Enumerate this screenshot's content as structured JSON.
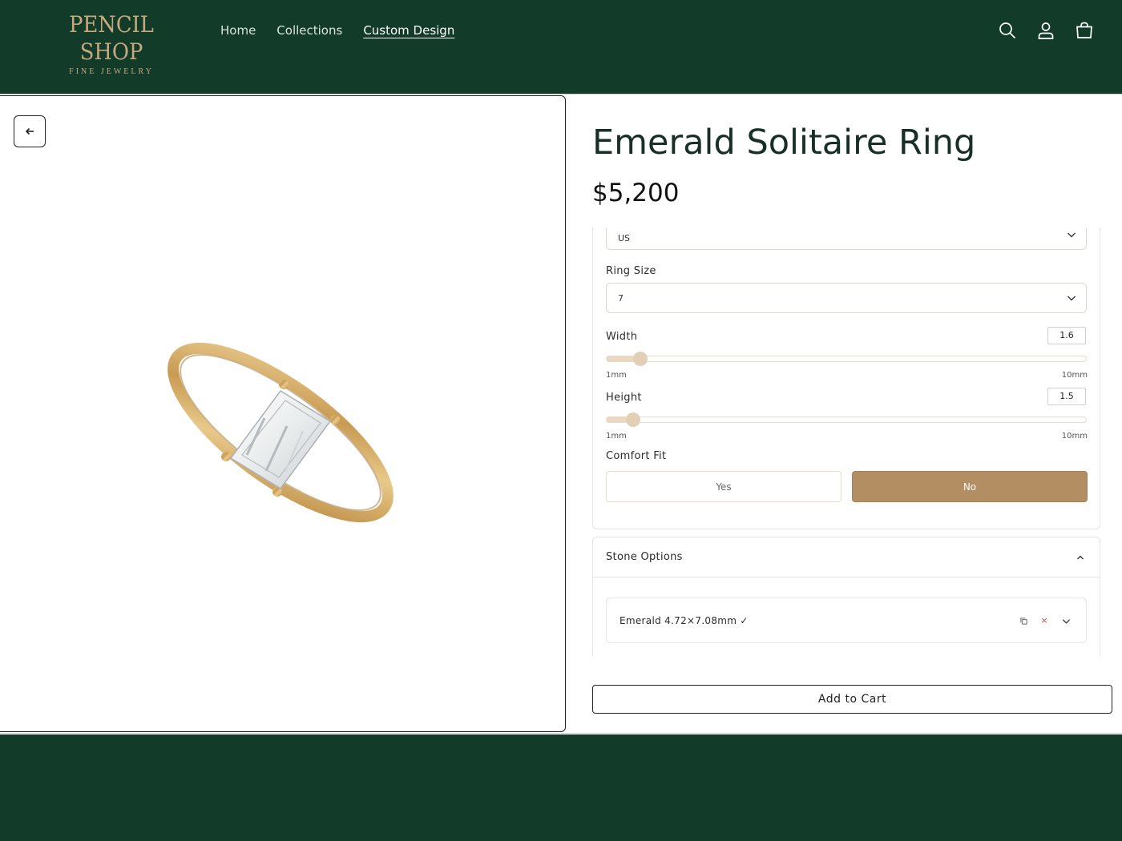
{
  "header": {
    "logo_main": "PENCIL SHOP",
    "logo_sub": "FINE JEWELRY",
    "nav": [
      {
        "label": "Home"
      },
      {
        "label": "Collections"
      },
      {
        "label": "Custom Design"
      }
    ],
    "active_nav": "Custom Design",
    "icons": [
      "search-icon",
      "account-icon",
      "cart-icon"
    ]
  },
  "gallery": {
    "back_icon": "arrow-left-icon",
    "image": "emerald-cut-solitaire-gold-ring"
  },
  "product": {
    "title": "Emerald Solitaire Ring",
    "price": "$5,200"
  },
  "options": {
    "size_region": {
      "value": "US"
    },
    "ring_size": {
      "label": "Ring Size",
      "value": "7"
    },
    "width": {
      "label": "Width",
      "value": "1.6",
      "min_label": "1mm",
      "max_label": "10mm",
      "fraction": 0.07
    },
    "height": {
      "label": "Height",
      "value": "1.5",
      "min_label": "1mm",
      "max_label": "10mm",
      "fraction": 0.055
    },
    "comfort_fit": {
      "label": "Comfort Fit",
      "choices": [
        "Yes",
        "No"
      ],
      "selected": "No"
    }
  },
  "stone_options": {
    "label": "Stone Options",
    "expanded": true,
    "items": [
      {
        "label": "Emerald 4.72×7.08mm ✓",
        "actions": [
          "copy-icon",
          "remove-icon",
          "chevron-down-icon"
        ]
      }
    ]
  },
  "cart": {
    "add_label": "Add to Cart"
  },
  "colors": {
    "brand_green": "#123b29",
    "accent_gold": "#b38e62",
    "logo_gold": "#c6a97d",
    "slider_tint": "#ead8c2"
  }
}
